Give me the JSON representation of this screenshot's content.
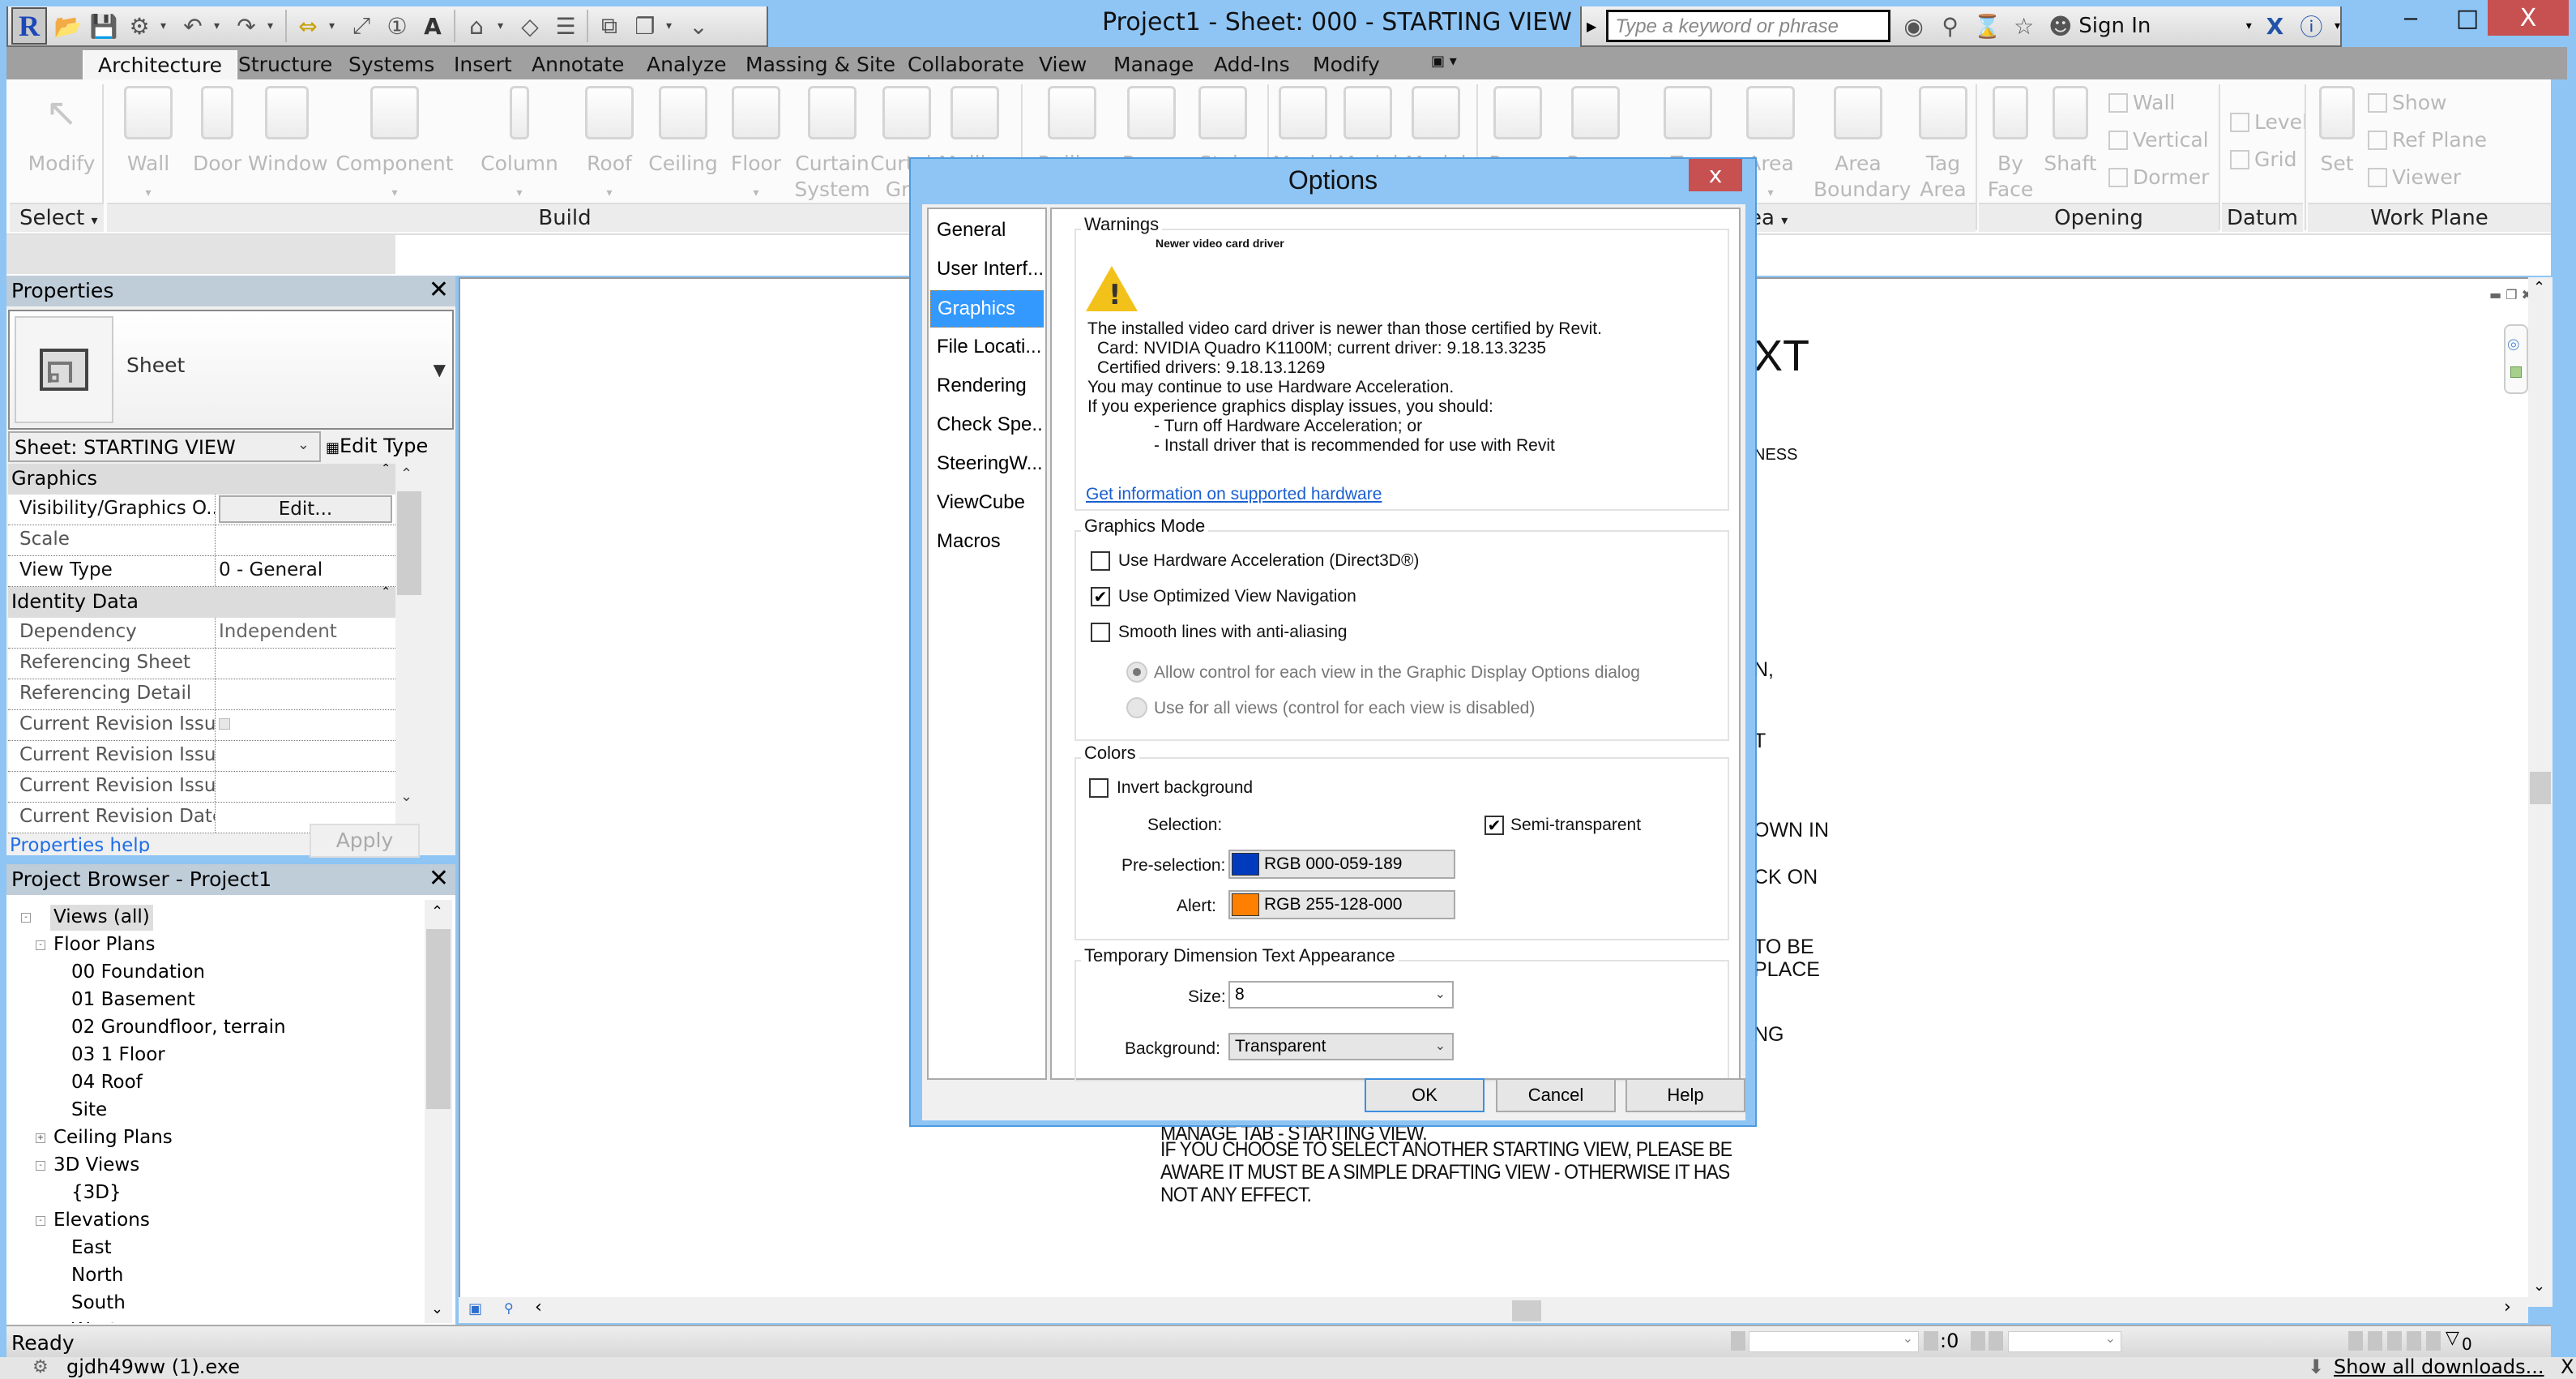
{
  "window": {
    "title": "Project1 - Sheet: 000 - STARTING VIEW",
    "minimize_icon": "minimize-icon",
    "maximize_icon": "maximize-icon",
    "close_label": "X"
  },
  "quick_access": {
    "app_letter": "R",
    "icons": [
      "open-icon",
      "save-icon",
      "sync-icon",
      "undo-icon",
      "redo-icon",
      "measure-icon",
      "dimension-icon",
      "tag-icon",
      "text-icon",
      "3d-view-icon",
      "section-icon",
      "thin-lines-icon",
      "close-hidden-icon",
      "switch-windows-icon",
      "customize-icon"
    ]
  },
  "infocenter": {
    "search_placeholder": "Type a keyword or phrase",
    "sign_in": "Sign In"
  },
  "ribbon": {
    "tabs": [
      "Architecture",
      "Structure",
      "Systems",
      "Insert",
      "Annotate",
      "Analyze",
      "Massing & Site",
      "Collaborate",
      "View",
      "Manage",
      "Add-Ins",
      "Modify"
    ],
    "active_tab": "Architecture",
    "buttons": {
      "modify": "Modify",
      "wall": "Wall",
      "door": "Door",
      "window": "Window",
      "component": "Component",
      "column": "Column",
      "roof": "Roof",
      "ceiling": "Ceiling",
      "floor": "Floor",
      "curtain_system": "Curtain System",
      "curtain_grid": "Curtain Grid",
      "mullion": "Mullion",
      "railing": "Railing",
      "ramp": "Ramp",
      "stair": "Stair",
      "model_text": "Model",
      "model_line": "Model",
      "model_group": "Model",
      "room": "Room",
      "room_separator": "Room",
      "tag_room": "Tag",
      "area": "Area",
      "area_boundary": "Area Boundary",
      "tag_area": "Tag Area",
      "by_face": "By Face",
      "shaft": "Shaft",
      "wall_opening": "Wall",
      "vertical": "Vertical",
      "dormer": "Dormer",
      "level": "Level",
      "grid": "Grid",
      "set": "Set",
      "show": "Show",
      "ref_plane": "Ref Plane",
      "viewer": "Viewer"
    },
    "panels": {
      "select": "Select",
      "build": "Build",
      "room_area": "ea",
      "opening": "Opening",
      "datum": "Datum",
      "work_plane": "Work Plane"
    }
  },
  "properties": {
    "title": "Properties",
    "type_name": "Sheet",
    "instance_selector": "Sheet: STARTING VIEW",
    "edit_type": "Edit Type",
    "groups": [
      {
        "name": "Graphics",
        "rows": [
          {
            "key": "Visibility/Graphics O...",
            "value": "Edit...",
            "button": true
          },
          {
            "key": "Scale",
            "value": ""
          },
          {
            "key": "View Type",
            "value": "0 - General"
          }
        ]
      },
      {
        "name": "Identity Data",
        "rows": [
          {
            "key": "Dependency",
            "value": "Independent"
          },
          {
            "key": "Referencing Sheet",
            "value": ""
          },
          {
            "key": "Referencing Detail",
            "value": ""
          },
          {
            "key": "Current Revision Issu...",
            "value": "",
            "checkbox": true
          },
          {
            "key": "Current Revision Issu...",
            "value": ""
          },
          {
            "key": "Current Revision Issu...",
            "value": ""
          },
          {
            "key": "Current Revision Date",
            "value": ""
          }
        ]
      }
    ],
    "help_link": "Properties help",
    "apply": "Apply"
  },
  "project_browser": {
    "title": "Project Browser - Project1",
    "tree": [
      {
        "label": "Views (all)",
        "level": 0,
        "toggle": "-",
        "selected": true
      },
      {
        "label": "Floor Plans",
        "level": 1,
        "toggle": "-"
      },
      {
        "label": "00 Foundation",
        "level": 2
      },
      {
        "label": "01 Basement",
        "level": 2
      },
      {
        "label": "02 Groundfloor, terrain",
        "level": 2
      },
      {
        "label": "03 1 Floor",
        "level": 2
      },
      {
        "label": "04 Roof",
        "level": 2
      },
      {
        "label": "Site",
        "level": 2
      },
      {
        "label": "Ceiling Plans",
        "level": 1,
        "toggle": "+"
      },
      {
        "label": "3D Views",
        "level": 1,
        "toggle": "-"
      },
      {
        "label": "{3D}",
        "level": 2
      },
      {
        "label": "Elevations",
        "level": 1,
        "toggle": "-"
      },
      {
        "label": "East",
        "level": 2
      },
      {
        "label": "North",
        "level": 2
      },
      {
        "label": "South",
        "level": 2
      },
      {
        "label": "West",
        "level": 2
      }
    ]
  },
  "canvas": {
    "fragments": [
      "XT",
      "NESS",
      "N,",
      "T",
      "OWN IN",
      "CK ON",
      "TO BE",
      "PLACE",
      "NG",
      "MANAGE TAB - STARTING VIEW."
    ],
    "lines": [
      "IF YOU CHOOSE TO SELECT ANOTHER STARTING VIEW, PLEASE BE",
      "AWARE IT MUST BE A SIMPLE DRAFTING VIEW - OTHERWISE IT HAS",
      "NOT ANY EFFECT."
    ]
  },
  "status_bar": {
    "text": "Ready",
    "selection_count": ":0",
    "filter_count": "0"
  },
  "downloads_bar": {
    "file": "gjdh49ww (1).exe",
    "show_all": "Show all downloads...",
    "close": "X"
  },
  "options_dialog": {
    "title": "Options",
    "close": "x",
    "nav": [
      "General",
      "User Interf...",
      "Graphics",
      "File Locati...",
      "Rendering",
      "Check Spe...",
      "SteeringW...",
      "ViewCube",
      "Macros"
    ],
    "active_nav": "Graphics",
    "warnings": {
      "group_title": "Warnings",
      "heading": "Newer video card driver",
      "lines": [
        "The installed video card driver is newer than those certified by Revit.",
        "Card: NVIDIA Quadro K1100M; current driver: 9.18.13.3235",
        "Certified drivers: 9.18.13.1269",
        "You may continue to use Hardware Acceleration.",
        "If you experience graphics display issues, you should:",
        "- Turn off Hardware Acceleration; or",
        "- Install driver that is recommended for use with Revit"
      ],
      "link": "Get information on supported hardware"
    },
    "graphics_mode": {
      "group_title": "Graphics Mode",
      "hardware_acceleration": {
        "label": "Use Hardware Acceleration (Direct3D®)",
        "checked": false
      },
      "optimized_navigation": {
        "label": "Use Optimized View Navigation",
        "checked": true
      },
      "anti_aliasing": {
        "label": "Smooth lines with anti-aliasing",
        "checked": false
      },
      "radio_per_view": {
        "label": "Allow control for each view in the Graphic Display Options dialog",
        "selected": true,
        "disabled": true
      },
      "radio_all_views": {
        "label": "Use for all views (control for each view is disabled)",
        "selected": false,
        "disabled": true
      }
    },
    "colors": {
      "group_title": "Colors",
      "invert_background": {
        "label": "Invert background",
        "checked": false
      },
      "selection_label": "Selection:",
      "semi_transparent": {
        "label": "Semi-transparent",
        "checked": true
      },
      "preselection_label": "Pre-selection:",
      "preselection_value": "RGB 000-059-189",
      "preselection_color": "#003bbd",
      "alert_label": "Alert:",
      "alert_value": "RGB 255-128-000",
      "alert_color": "#ff8000"
    },
    "temp_dimension": {
      "group_title": "Temporary Dimension Text Appearance",
      "size_label": "Size:",
      "size_value": "8",
      "background_label": "Background:",
      "background_value": "Transparent"
    },
    "buttons": {
      "ok": "OK",
      "cancel": "Cancel",
      "help": "Help"
    }
  }
}
